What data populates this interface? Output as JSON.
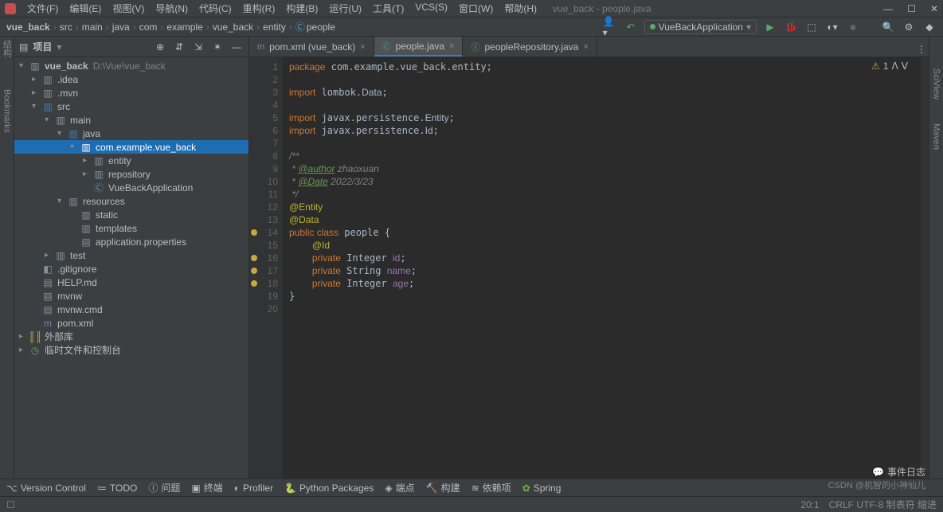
{
  "window": {
    "title": "vue_back - people.java"
  },
  "menus": [
    "文件(F)",
    "编辑(E)",
    "视图(V)",
    "导航(N)",
    "代码(C)",
    "重构(R)",
    "构建(B)",
    "运行(U)",
    "工具(T)",
    "VCS(S)",
    "窗口(W)",
    "帮助(H)"
  ],
  "breadcrumb": [
    "vue_back",
    "src",
    "main",
    "java",
    "com",
    "example",
    "vue_back",
    "entity",
    "people"
  ],
  "run_config": "VueBackApplication",
  "sidebar": {
    "title": "项目"
  },
  "tree": {
    "root": {
      "name": "vue_back",
      "path": "D:\\Vue\\vue_back"
    },
    "items": [
      ".idea",
      ".mvn",
      "src",
      "main",
      "java",
      "com.example.vue_back",
      "entity",
      "repository",
      "VueBackApplication",
      "resources",
      "static",
      "templates",
      "application.properties",
      "test",
      ".gitignore",
      "HELP.md",
      "mvnw",
      "mvnw.cmd",
      "pom.xml",
      "外部库",
      "临时文件和控制台"
    ]
  },
  "tabs": [
    {
      "label": "pom.xml (vue_back)",
      "icon": "m",
      "active": false
    },
    {
      "label": "people.java",
      "icon": "C",
      "active": true
    },
    {
      "label": "peopleRepository.java",
      "icon": "I",
      "active": false
    }
  ],
  "warning_count": "1",
  "code": {
    "lines": [
      "package com.example.vue_back.entity;",
      "",
      "import lombok.Data;",
      "",
      "import javax.persistence.Entity;",
      "import javax.persistence.Id;",
      "",
      "/**",
      " * @author zhaoxuan",
      " * @Date 2022/3/23",
      " */",
      "@Entity",
      "@Data",
      "public class people {",
      "    @Id",
      "    private Integer id;",
      "    private String name;",
      "    private Integer age;",
      "}",
      ""
    ]
  },
  "footer": [
    "Version Control",
    "TODO",
    "问题",
    "终端",
    "Profiler",
    "Python Packages",
    "端点",
    "构建",
    "依赖项",
    "Spring"
  ],
  "eventlog": "事件日志",
  "status": {
    "pos": "20:1",
    "enc": "CRLF  UTF-8  制表符  缩进"
  },
  "watermark": "CSDN @机智的小神仙儿",
  "left_tools": [
    "结构",
    "Bookmarks"
  ],
  "right_tools": [
    "SciView",
    "Maven"
  ]
}
